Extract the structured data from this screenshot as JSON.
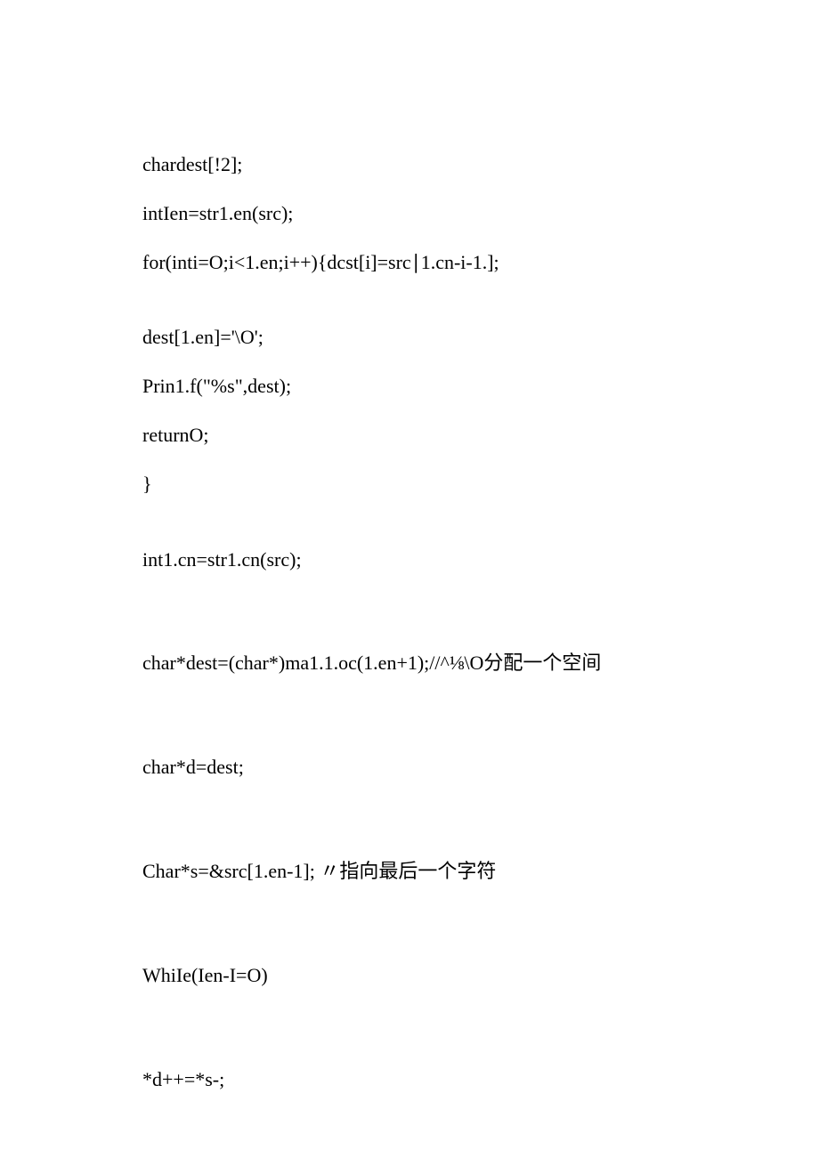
{
  "lines": [
    "chardest[!2];",
    "intIen=str1.en(src);",
    "for(inti=O;i<1.en;i++){dcst[i]=src∣1.cn-i-1.];",
    "dest[1.en]='\\O';",
    "Prin1.f(\"%s\",dest);",
    "returnO;",
    "}",
    "int1.cn=str1.cn(src);",
    "char*dest=(char*)ma1.1.oc(1.en+1);//^⅛\\O分配一个空间",
    "char*d=dest;",
    "Char*s=&src[1.en-1]; 〃指向最后一个字符",
    "WhiIe(Ien-I=O)",
    "*d++=*s-;"
  ]
}
